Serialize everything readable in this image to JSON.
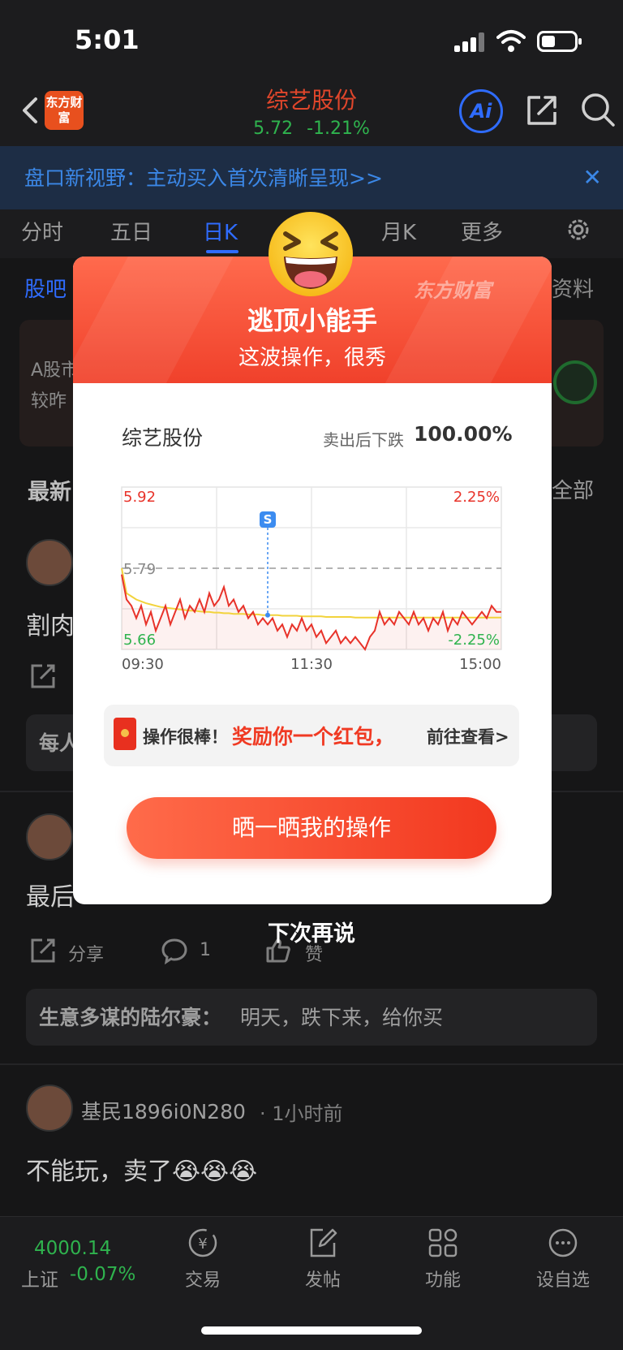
{
  "status_bar": {
    "time": "5:01"
  },
  "nav": {
    "logo_text": "东方财富",
    "stock_name": "综艺股份",
    "price": "5.72",
    "change_pct": "-1.21%",
    "ai_label": "Ai"
  },
  "banner": {
    "text": "盘口新视野：主动买入首次清晰呈现>>",
    "close": "✕"
  },
  "chart_tabs": {
    "items": [
      "分时",
      "五日",
      "日K",
      "月K",
      "更多"
    ]
  },
  "content_tabs": {
    "left": "股吧",
    "right": "资料"
  },
  "promo": {
    "line1": "A股市",
    "line2": "较昨"
  },
  "feed": {
    "section": "最新",
    "filter": "全部",
    "post1_text": "割肉",
    "comment1_author": "每人",
    "post2_text": "最后",
    "share_label": "分享",
    "comment_count": "1",
    "like_label": "赞",
    "comment2_author": "生意多谋的陆尔豪：",
    "comment2_text": "明天，跌下来，给你买",
    "post3_user": "基民1896i0N280",
    "post3_time": "· 1小时前",
    "post3_text": "不能玩，卖了😭😭😭"
  },
  "bottom_bar": {
    "index_value": "4000.14",
    "index_name": "上证",
    "index_change": "-0.07%",
    "trade": "交易",
    "post": "发帖",
    "features": "功能",
    "watchlist": "设自选"
  },
  "modal": {
    "brand": "东方财富",
    "title": "逃顶小能手",
    "subtitle": "这波操作，很秀",
    "stock_name": "综艺股份",
    "result_label": "卖出后下跌",
    "result_value": "100.00%",
    "reward_pre": "操作很棒！",
    "reward_main": "奖励你一个红包，",
    "reward_link": "前往查看>",
    "share_button": "晒一晒我的操作",
    "dismiss": "下次再说"
  },
  "chart_data": {
    "type": "line",
    "title": "",
    "xlabel": "",
    "ylabel": "",
    "x_ticks": [
      "09:30",
      "11:30",
      "15:00"
    ],
    "y_left_ticks": [
      "5.92",
      "5.79",
      "5.66"
    ],
    "y_right_ticks": [
      "2.25%",
      "-2.25%"
    ],
    "ylim": [
      5.66,
      5.92
    ],
    "prev_close": 5.79,
    "sell_marker": {
      "label": "S",
      "time_index": 30,
      "price": 5.715
    },
    "colors": {
      "price": "#e8332a",
      "avg": "#f2d33c",
      "up": "#e8332a",
      "down": "#2fb34e"
    },
    "series": [
      {
        "role": "price",
        "values": [
          5.78,
          5.74,
          5.73,
          5.71,
          5.73,
          5.7,
          5.72,
          5.69,
          5.71,
          5.73,
          5.7,
          5.72,
          5.74,
          5.71,
          5.73,
          5.72,
          5.74,
          5.72,
          5.75,
          5.73,
          5.74,
          5.76,
          5.73,
          5.74,
          5.72,
          5.73,
          5.71,
          5.72,
          5.7,
          5.71,
          5.7,
          5.71,
          5.69,
          5.7,
          5.68,
          5.7,
          5.69,
          5.71,
          5.69,
          5.7,
          5.68,
          5.69,
          5.67,
          5.68,
          5.69,
          5.67,
          5.68,
          5.67,
          5.68,
          5.67,
          5.66,
          5.68,
          5.69,
          5.72,
          5.7,
          5.71,
          5.7,
          5.72,
          5.71,
          5.7,
          5.72,
          5.7,
          5.71,
          5.69,
          5.71,
          5.7,
          5.72,
          5.69,
          5.71,
          5.7,
          5.72,
          5.71,
          5.7,
          5.71,
          5.72,
          5.71,
          5.73,
          5.72,
          5.72
        ]
      },
      {
        "role": "average",
        "values": [
          5.79,
          5.75,
          5.745,
          5.74,
          5.737,
          5.734,
          5.732,
          5.73,
          5.728,
          5.727,
          5.726,
          5.725,
          5.724,
          5.723,
          5.722,
          5.722,
          5.721,
          5.72,
          5.72,
          5.719,
          5.719,
          5.718,
          5.718,
          5.717,
          5.717,
          5.717,
          5.716,
          5.716,
          5.716,
          5.715,
          5.715,
          5.715,
          5.715,
          5.714,
          5.714,
          5.714,
          5.714,
          5.713,
          5.713,
          5.713,
          5.713,
          5.713,
          5.712,
          5.712,
          5.712,
          5.712,
          5.712,
          5.712,
          5.711,
          5.711,
          5.711,
          5.711,
          5.711,
          5.711,
          5.711,
          5.711,
          5.711,
          5.711,
          5.711,
          5.711,
          5.711,
          5.711,
          5.711,
          5.711,
          5.711,
          5.711,
          5.711,
          5.711,
          5.711,
          5.711,
          5.711,
          5.711,
          5.711,
          5.711,
          5.711,
          5.711,
          5.711,
          5.711,
          5.711
        ]
      }
    ]
  }
}
